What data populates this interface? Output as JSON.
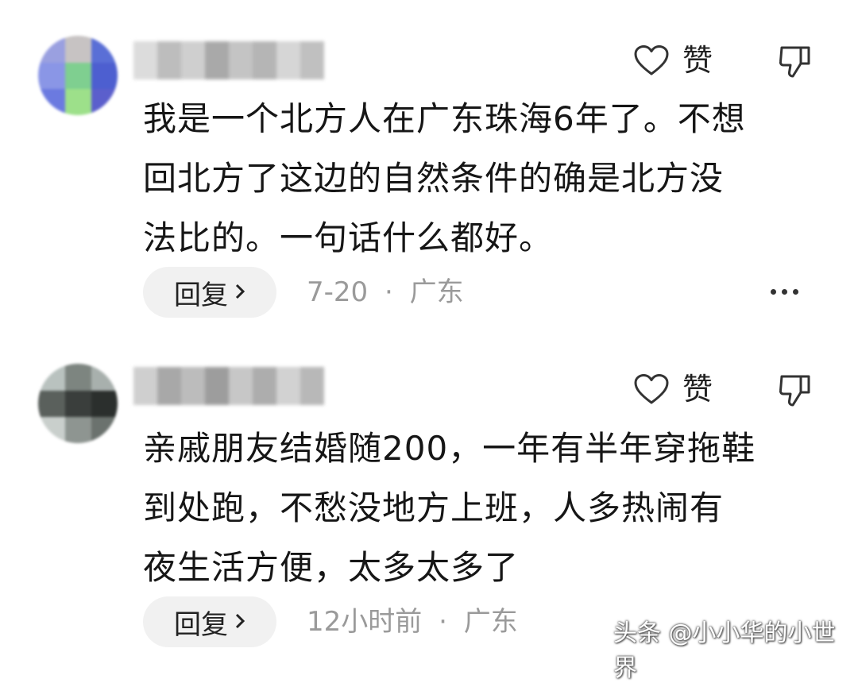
{
  "comments": [
    {
      "like_label": "赞",
      "text_lines": [
        "我是一个北方人在广东珠海6年了。不想",
        "回北方了这边的自然条件的确是北方没",
        "法比的。一句话什么都好。"
      ],
      "reply_label": "回复",
      "time": "7-20",
      "separator": "·",
      "location": "广东"
    },
    {
      "like_label": "赞",
      "text_lines": [
        "亲戚朋友结婚随200，一年有半年穿拖鞋",
        "到处跑，不愁没地方上班，人多热闹有",
        "夜生活方便，太多太多了"
      ],
      "reply_label": "回复",
      "time": "12小时前",
      "separator": "·",
      "location": "广东"
    }
  ],
  "icons": {
    "like": "heart-icon",
    "dislike": "thumbs-down-icon",
    "reply_chevron": "chevron-right-icon",
    "more": "more-dots-icon"
  },
  "watermark": "头条 @小小华的小世界"
}
